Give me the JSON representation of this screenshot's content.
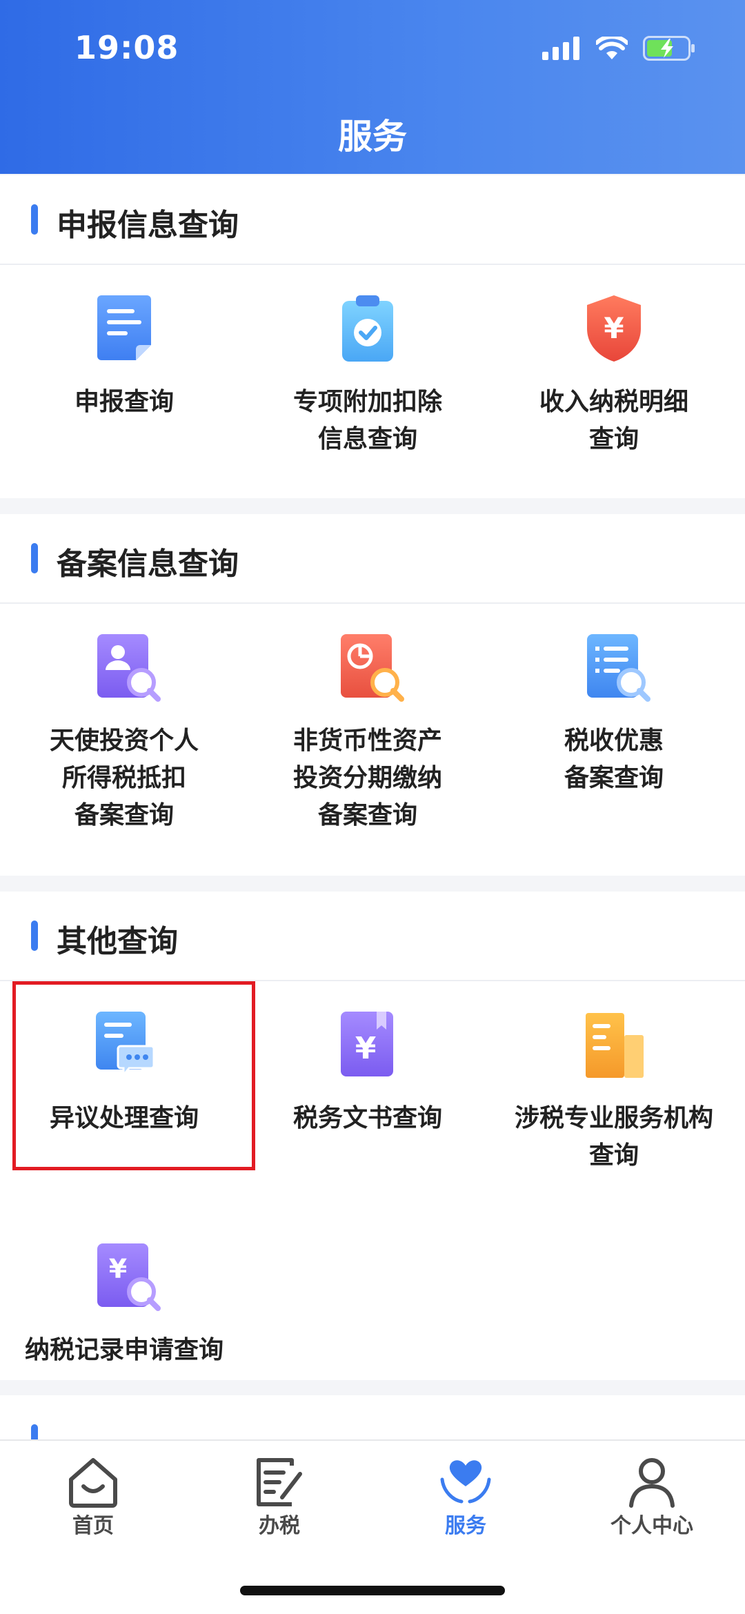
{
  "status_bar": {
    "time": "19:08"
  },
  "header": {
    "title": "服务"
  },
  "sections": [
    {
      "title": "申报信息查询",
      "items": [
        {
          "label": "申报查询",
          "icon": "document-icon"
        },
        {
          "label": "专项附加扣除\n信息查询",
          "icon": "clipboard-check-icon"
        },
        {
          "label": "收入纳税明细\n查询",
          "icon": "yuan-shield-icon"
        }
      ]
    },
    {
      "title": "备案信息查询",
      "items": [
        {
          "label": "天使投资个人\n所得税抵扣\n备案查询",
          "icon": "person-search-icon"
        },
        {
          "label": "非货币性资产\n投资分期缴纳\n备案查询",
          "icon": "pie-search-icon"
        },
        {
          "label": "税收优惠\n备案查询",
          "icon": "list-search-icon"
        }
      ]
    },
    {
      "title": "其他查询",
      "items": [
        {
          "label": "异议处理查询",
          "icon": "message-document-icon"
        },
        {
          "label": "税务文书查询",
          "icon": "yuan-book-icon"
        },
        {
          "label": "涉税专业服务机构\n查询",
          "icon": "building-icon"
        },
        {
          "label": "纳税记录申请查询",
          "icon": "yuan-search-icon"
        }
      ]
    }
  ],
  "tabbar": {
    "tabs": [
      {
        "label": "首页",
        "icon": "home-icon"
      },
      {
        "label": "办税",
        "icon": "edit-document-icon"
      },
      {
        "label": "服务",
        "icon": "heart-hands-icon",
        "active": true
      },
      {
        "label": "个人中心",
        "icon": "person-icon"
      }
    ]
  },
  "colors": {
    "accent": "#3b7cf0",
    "highlight": "#e21b23"
  }
}
